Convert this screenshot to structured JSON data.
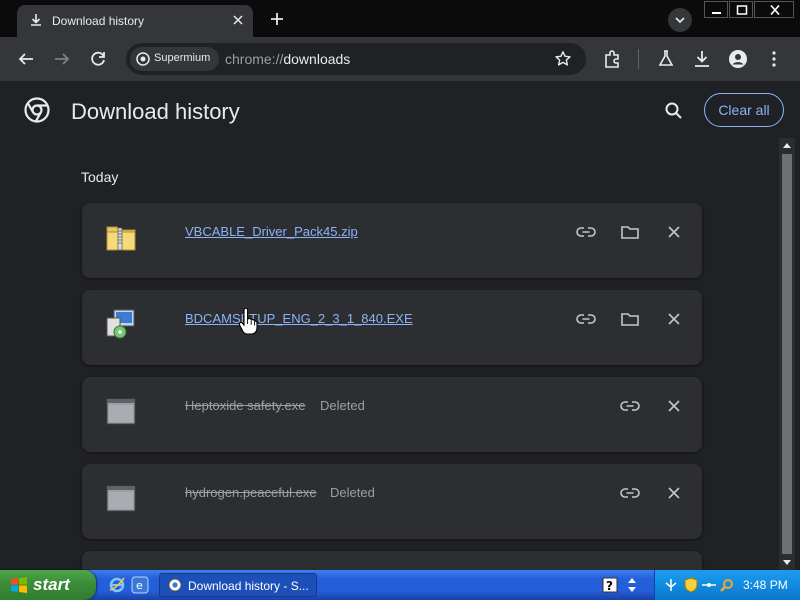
{
  "tab": {
    "title": "Download history"
  },
  "toolbar": {
    "chip_label": "Supermium",
    "url_scheme": "chrome://",
    "url_host": "downloads"
  },
  "page": {
    "title": "Download history",
    "clear_all_label": "Clear all",
    "section_label": "Today"
  },
  "downloads": [
    {
      "name": "VBCABLE_Driver_Pack45.zip",
      "status": "",
      "icon": "zip-folder-icon"
    },
    {
      "name": "BDCAMSETUP_ENG_2_3_1_840.EXE",
      "status": "",
      "icon": "setup-exe-icon"
    },
    {
      "name": "Heptoxide safety.exe",
      "status": "Deleted",
      "icon": "window-app-icon"
    },
    {
      "name": "hydrogen.peaceful.exe",
      "status": "Deleted",
      "icon": "window-app-icon"
    }
  ],
  "taskbar": {
    "start_label": "start",
    "task_label": "Download history - S...",
    "clock": "3:48 PM"
  },
  "colors": {
    "link": "#8ab4f8",
    "card": "#2d2e31",
    "background": "#202124"
  }
}
